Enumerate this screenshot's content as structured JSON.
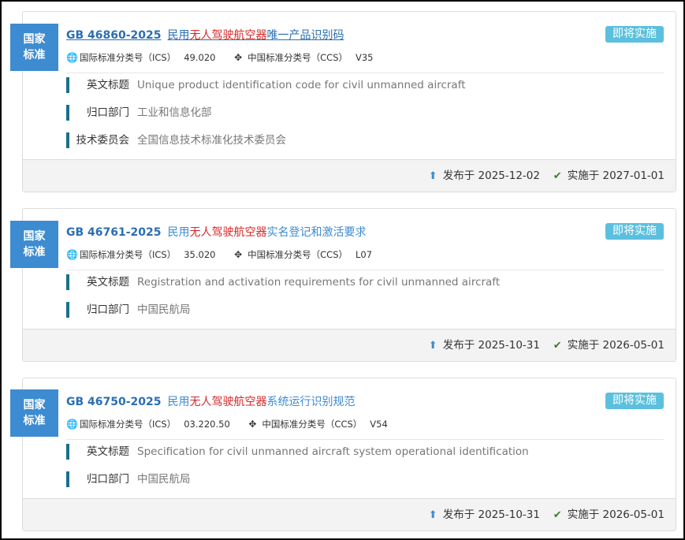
{
  "badge": {
    "line1": "国家",
    "line2": "标准"
  },
  "labels": {
    "ics": "国际标准分类号（ICS）",
    "ccs": "中国标准分类号（CCS）",
    "english_title": "英文标题",
    "dept": "归口部门",
    "committee": "技术委员会",
    "published": "发布于",
    "implemented": "实施于"
  },
  "icons": {
    "ics": "globe-icon",
    "ccs": "move-arrows-icon",
    "published": "upload-icon",
    "implemented": "check-icon"
  },
  "colors": {
    "badge": "#3d8bd0",
    "status": "#5bc0de",
    "highlight": "#d62828",
    "code": "#2a6eb5"
  },
  "standards": [
    {
      "code": "GB 46860-2025",
      "name_pre": "民用",
      "name_hl": "无人驾驶航空器",
      "name_post": "唯一产品识别码",
      "status": "即将实施",
      "ics": "49.020",
      "ccs": "V35",
      "english_title": "Unique product identification code for civil unmanned aircraft",
      "dept": "工业和信息化部",
      "committee": "全国信息技术标准化技术委员会",
      "published": "2025-12-02",
      "implemented": "2027-01-01"
    },
    {
      "code": "GB 46761-2025",
      "name_pre": "民用",
      "name_hl": "无人驾驶航空器",
      "name_post": "实名登记和激活要求",
      "status": "即将实施",
      "ics": "35.020",
      "ccs": "L07",
      "english_title": "Registration and activation requirements for civil unmanned aircraft",
      "dept": "中国民航局",
      "published": "2025-10-31",
      "implemented": "2026-05-01"
    },
    {
      "code": "GB 46750-2025",
      "name_pre": "民用",
      "name_hl": "无人驾驶航空器",
      "name_post": "系统运行识别规范",
      "status": "即将实施",
      "ics": "03.220.50",
      "ccs": "V54",
      "english_title": "Specification for civil unmanned aircraft system operational identification",
      "dept": "中国民航局",
      "published": "2025-10-31",
      "implemented": "2026-05-01"
    }
  ]
}
